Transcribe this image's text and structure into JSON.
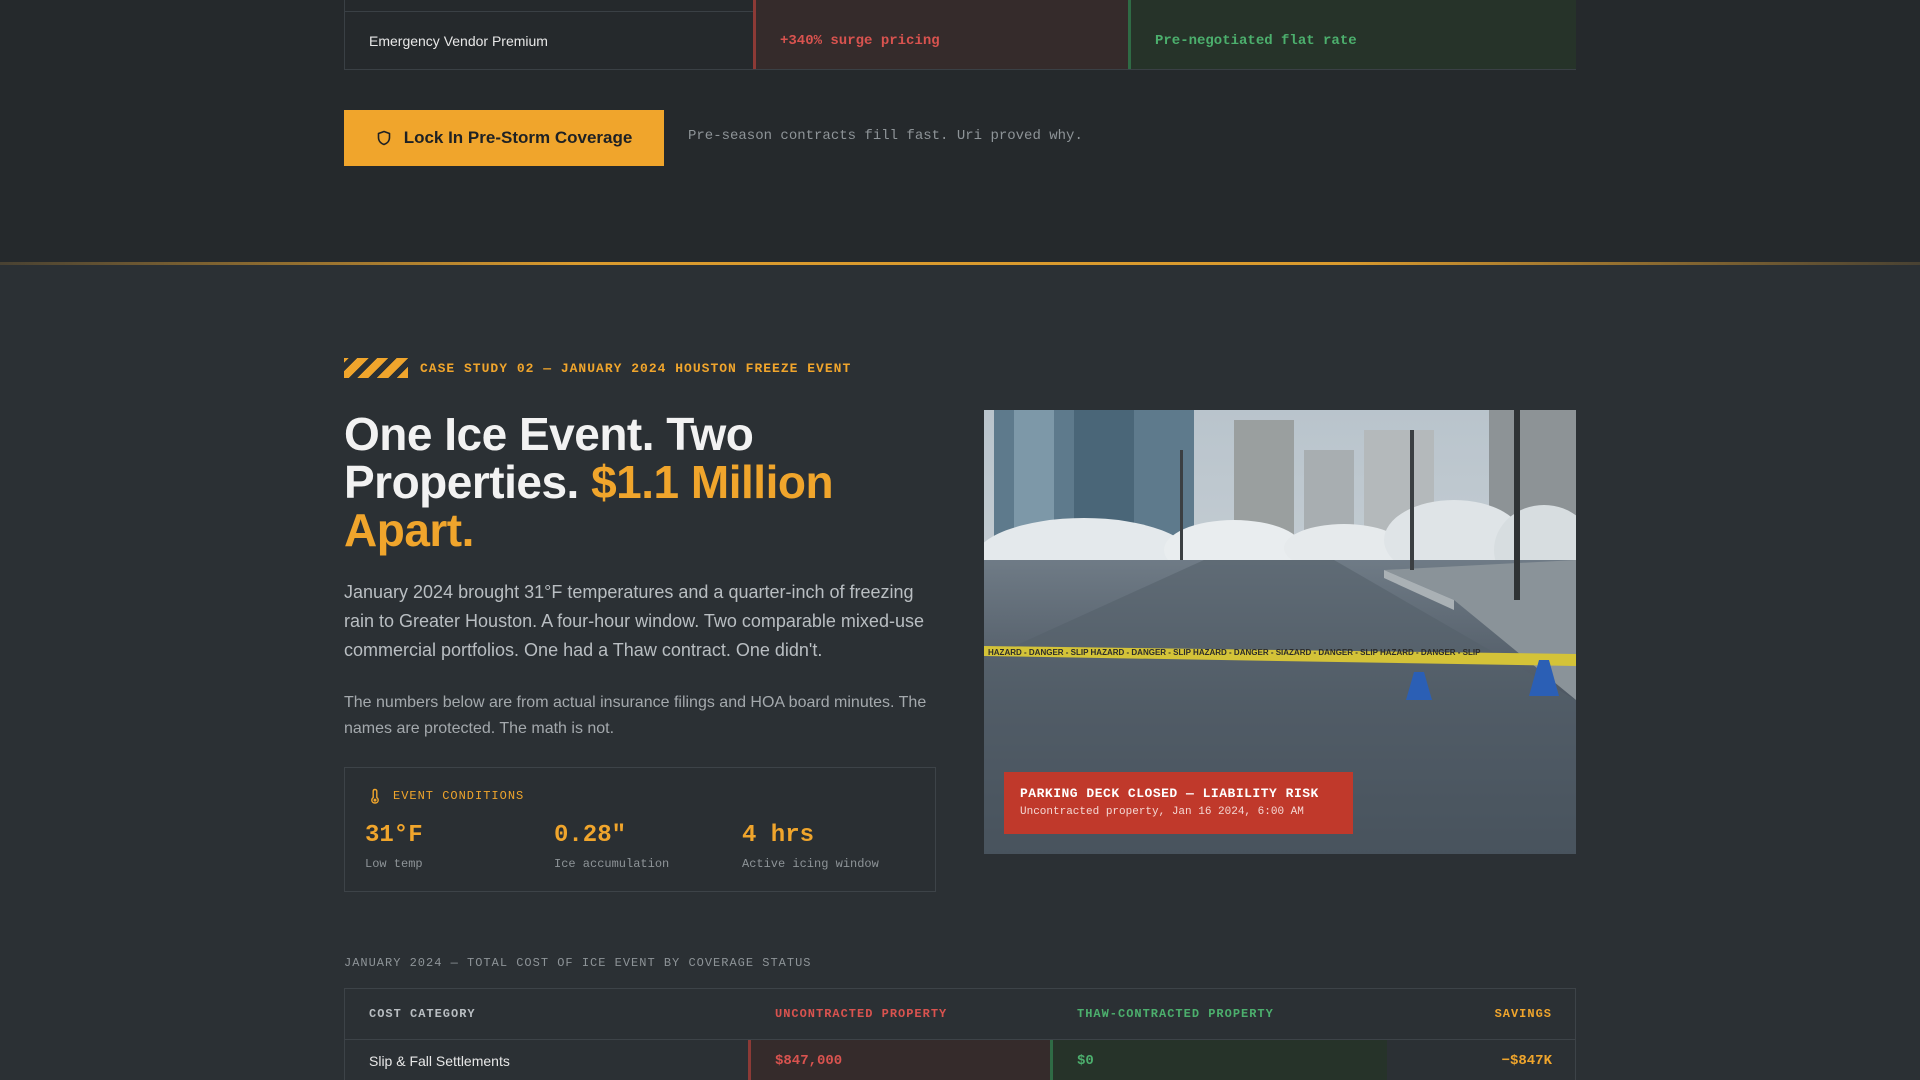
{
  "vendor_row": {
    "label": "Emergency Vendor Premium",
    "uncontracted": "+340% surge pricing",
    "contracted": "Pre-negotiated flat rate"
  },
  "cta": {
    "button_label": "Lock In Pre-Storm Coverage",
    "icon": "shield-icon",
    "note": "Pre-season contracts fill fast. Uri proved why."
  },
  "case_study": {
    "eyebrow": "CASE STUDY 02 — JANUARY 2024 HOUSTON FREEZE EVENT",
    "headline_main": "One Ice Event. Two Properties. ",
    "headline_accent": "$1.1 Million Apart.",
    "lead": "January 2024 brought 31°F temperatures and a quarter-inch of freezing rain to Greater Houston. A four-hour window. Two comparable mixed-use commercial portfolios. One had a Thaw contract. One didn't.",
    "sub": "The numbers below are from actual insurance filings and HOA board minutes. The names are protected. The math is not."
  },
  "conditions": {
    "title": "EVENT CONDITIONS",
    "icon": "thermometer-icon",
    "stats": [
      {
        "value": "31°F",
        "label": "Low temp"
      },
      {
        "value": "0.28\"",
        "label": "Ice accumulation"
      },
      {
        "value": "4 hrs",
        "label": "Active icing window"
      }
    ]
  },
  "photo": {
    "tape_text": "HAZARD - DANGER - SLIP HAZARD - DANGER - SLIP HAZARD - DANGER - SIAZARD - DANGER - SLIP HAZARD - DANGER - SLIP",
    "caption_title": "PARKING DECK CLOSED — LIABILITY RISK",
    "caption_sub": "Uncontracted property, Jan 16 2024, 6:00 AM"
  },
  "cost_table": {
    "title": "JANUARY 2024 — TOTAL COST OF ICE EVENT BY COVERAGE STATUS",
    "headers": [
      "COST CATEGORY",
      "UNCONTRACTED PROPERTY",
      "THAW-CONTRACTED PROPERTY",
      "SAVINGS"
    ],
    "rows": [
      {
        "category": "Slip & Fall Settlements",
        "uncontracted": "$847,000",
        "contracted": "$0",
        "savings": "−$847K"
      }
    ]
  },
  "colors": {
    "accent": "#f0a52c",
    "danger": "#d9534f",
    "success": "#4caf6d",
    "background": "#2b3034"
  }
}
